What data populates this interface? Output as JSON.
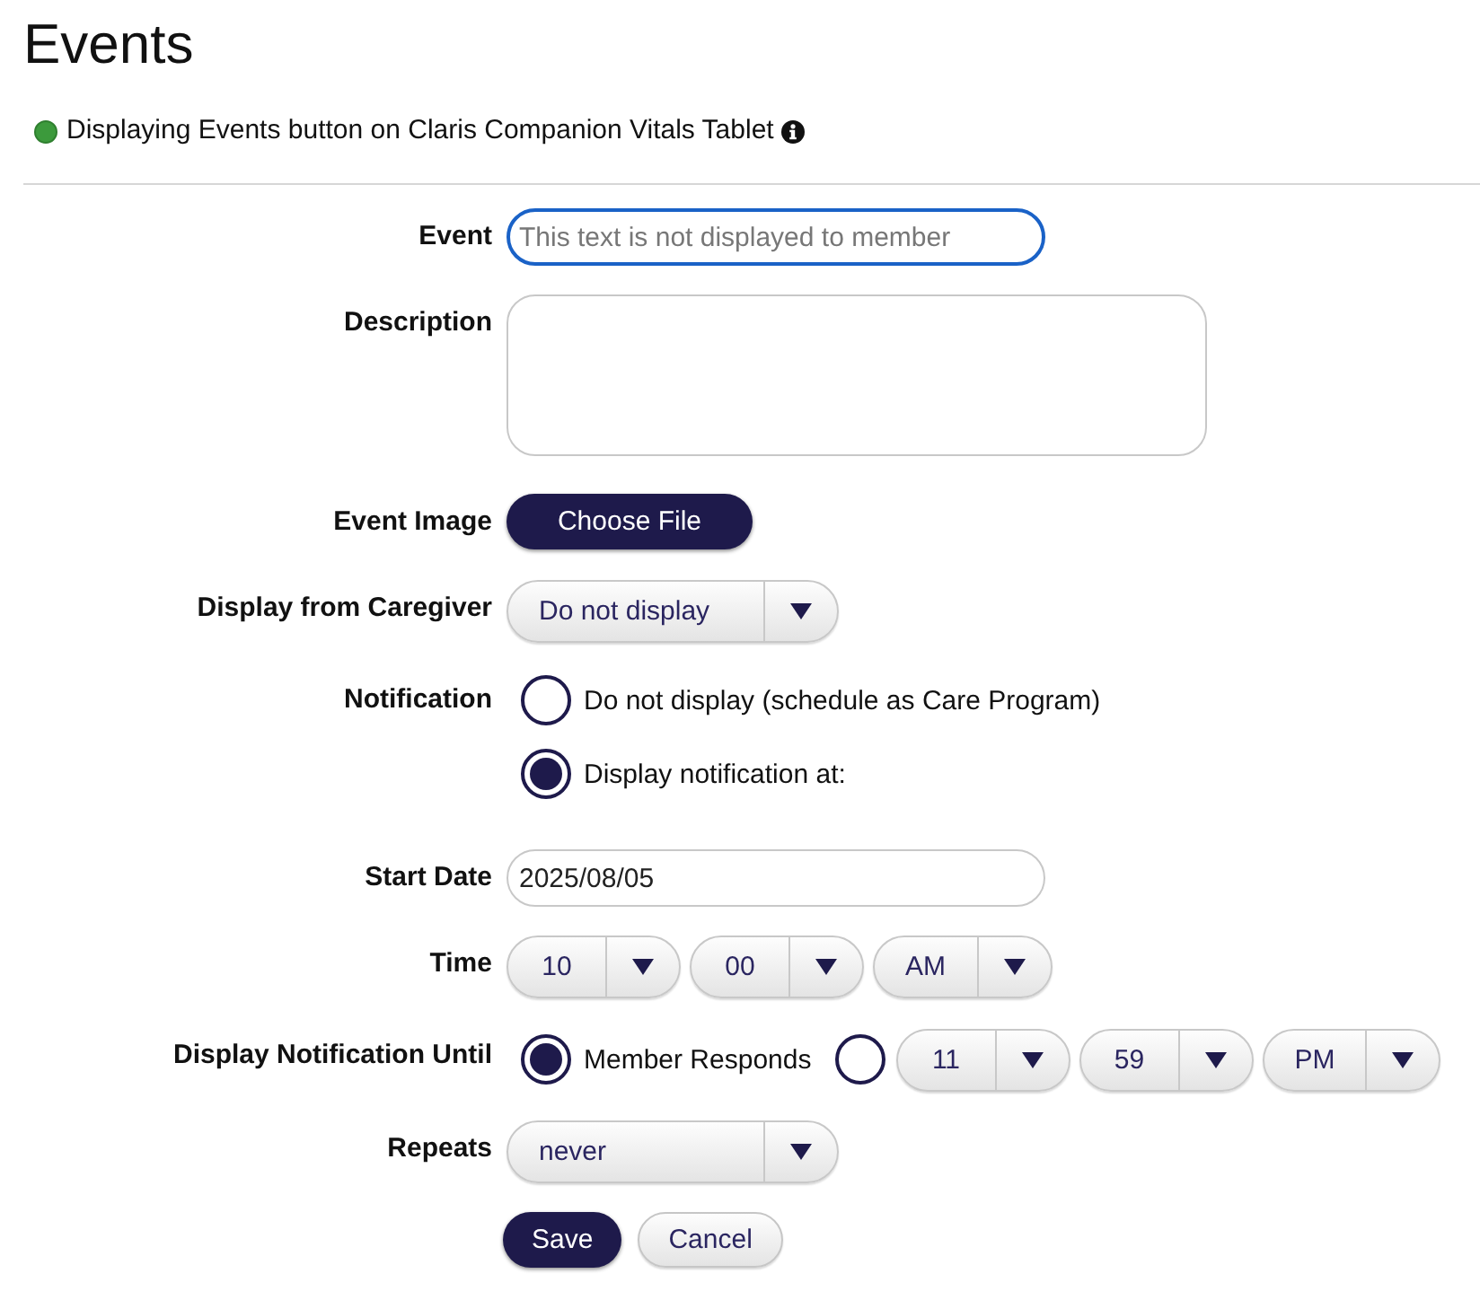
{
  "title": "Events",
  "status": {
    "active": true,
    "text": "Displaying Events button on Claris Companion Vitals Tablet"
  },
  "fields": [
    {
      "kind": "text",
      "label": "Event",
      "placeholder": "This text is not displayed to member",
      "focused": true
    },
    {
      "kind": "textarea",
      "label": "Description"
    },
    {
      "kind": "file",
      "label": "Event Image",
      "button": "Choose File"
    },
    {
      "kind": "select",
      "label": "Display from Caregiver",
      "value": "Do not display"
    },
    {
      "kind": "radios",
      "label": "Notification",
      "options": [
        {
          "label": "Do not display (schedule as Care Program)",
          "selected": false
        },
        {
          "label": "Display notification at:",
          "selected": true
        }
      ]
    },
    {
      "kind": "text",
      "label": "Start Date",
      "value": "2025/08/05",
      "focused": false
    },
    {
      "kind": "time",
      "label": "Time",
      "selects": [
        {
          "value": "10"
        },
        {
          "value": "00"
        },
        {
          "value": "AM"
        }
      ]
    },
    {
      "kind": "until",
      "label": "Display Notification Until",
      "options": [
        {
          "label": "Member Responds",
          "selected": true
        },
        {
          "selected": false,
          "selects": [
            {
              "value": "11"
            },
            {
              "value": "59"
            },
            {
              "value": "PM"
            }
          ]
        }
      ]
    },
    {
      "kind": "select",
      "label": "Repeats",
      "value": "never"
    }
  ],
  "buttons": [
    {
      "label": "Save",
      "kind": "primary"
    },
    {
      "label": "Cancel",
      "kind": "secondary"
    }
  ]
}
